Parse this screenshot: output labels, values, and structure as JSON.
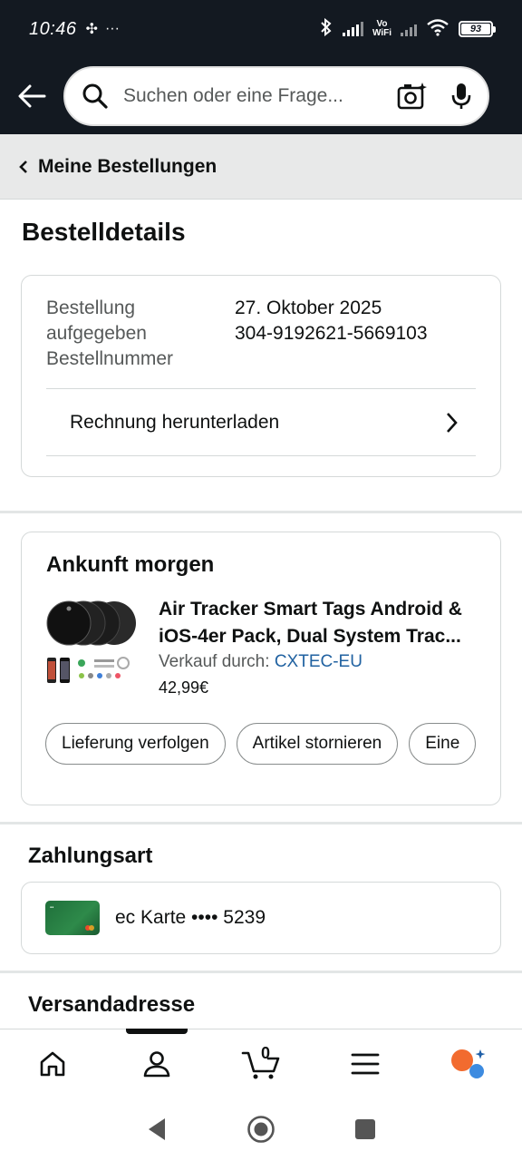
{
  "status_bar": {
    "time": "10:46",
    "extra": "···",
    "vowifi_top": "Vo",
    "vowifi_bottom": "WiFi",
    "battery": "93",
    "battery_level_pct": 93
  },
  "header": {
    "search_placeholder": "Suchen oder eine Frage..."
  },
  "breadcrumb": {
    "label": "Meine Bestellungen"
  },
  "page": {
    "title": "Bestelldetails"
  },
  "order": {
    "placed_label_line1": "Bestellung",
    "placed_label_line2": "aufgegeben",
    "number_label": "Bestellnummer",
    "placed_value": "27. Oktober 2025",
    "number_value": "304-9192621-5669103",
    "invoice_label": "Rechnung herunterladen"
  },
  "arrival": {
    "title": "Ankunft morgen",
    "product_title_line1": "Air Tracker Smart Tags Android &",
    "product_title_line2": "iOS-4er Pack, Dual System Trac...",
    "sold_by_label": "Verkauf durch:",
    "seller": "CXTEC-EU",
    "price": "42,99€",
    "actions": [
      "Lieferung verfolgen",
      "Artikel stornieren",
      "Eine"
    ]
  },
  "payment": {
    "title": "Zahlungsart",
    "card_text": "ec Karte •••• 5239"
  },
  "shipping": {
    "title": "Versandadresse"
  },
  "bottom_nav": {
    "cart_count": "0",
    "items": [
      "home-icon",
      "account-icon",
      "cart-icon",
      "menu-icon",
      "rufus-icon"
    ]
  },
  "colors": {
    "header_bg": "#131921",
    "link": "#2162a1",
    "breadcrumb_bg": "#e8e9e9"
  }
}
